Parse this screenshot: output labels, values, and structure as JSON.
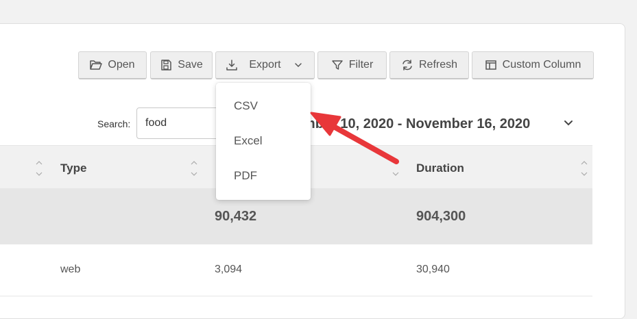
{
  "toolbar": {
    "open_label": "Open",
    "save_label": "Save",
    "export_label": "Export",
    "filter_label": "Filter",
    "refresh_label": "Refresh",
    "custom_column_label": "Custom Column"
  },
  "export_menu": {
    "items": [
      "CSV",
      "Excel",
      "PDF"
    ]
  },
  "search": {
    "label": "Search:",
    "value": "food"
  },
  "date_range": "November 10, 2020 - November 16, 2020",
  "table": {
    "headers": [
      "Type",
      "",
      "Duration"
    ],
    "total_row": [
      "",
      "90,432",
      "904,300"
    ],
    "rows": [
      [
        "web",
        "3,094",
        "30,940"
      ]
    ]
  },
  "colors": {
    "annotation_arrow": "#e8373a",
    "toolbar_button": "#efefef",
    "total_row": "#e6e6e6"
  }
}
